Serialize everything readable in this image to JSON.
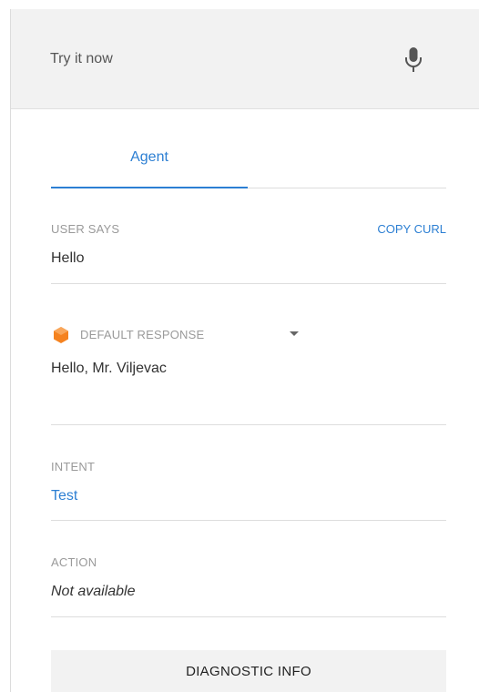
{
  "query_bar": {
    "placeholder": "Try it now",
    "mic_icon": "microphone-icon"
  },
  "tabs": [
    {
      "label": "Agent",
      "active": true
    }
  ],
  "user_says": {
    "label": "USER SAYS",
    "value": "Hello",
    "copy_curl_label": "COPY CURL"
  },
  "response": {
    "label": "DEFAULT RESPONSE",
    "icon": "hexagon-icon",
    "value": "Hello, Mr. Viljevac"
  },
  "intent": {
    "label": "INTENT",
    "value": "Test"
  },
  "action": {
    "label": "ACTION",
    "value": "Not available"
  },
  "diagnostic": {
    "label": "DIAGNOSTIC INFO"
  },
  "colors": {
    "accent": "#2c7fd3",
    "response_icon": "#f5821f"
  }
}
